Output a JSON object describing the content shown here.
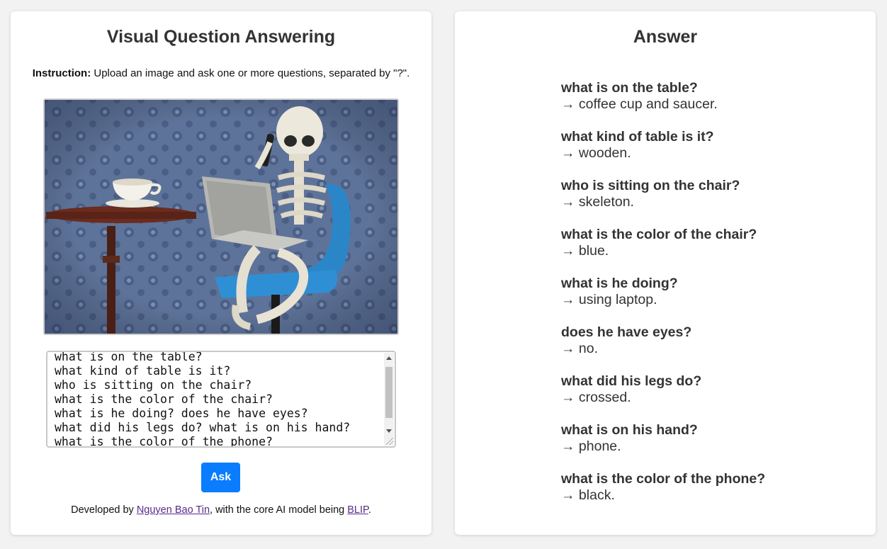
{
  "left": {
    "title": "Visual Question Answering",
    "instruction_label": "Instruction:",
    "instruction_text": " Upload an image and ask one or more questions, separated by \"?\".",
    "questions_text": "what is on the table?\nwhat kind of table is it?\nwho is sitting on the chair?\nwhat is the color of the chair?\nwhat is he doing? does he have eyes?\nwhat did his legs do? what is on his hand?\nwhat is the color of the phone?",
    "ask_label": "Ask",
    "footer": {
      "prefix": "Developed by ",
      "author": "Nguyen Bao Tin",
      "middle": ", with the core AI model being ",
      "model": "BLIP",
      "suffix": "."
    }
  },
  "right": {
    "title": "Answer",
    "answers": [
      {
        "q": "what is on the table?",
        "a": "→ coffee cup and saucer."
      },
      {
        "q": "what kind of table is it?",
        "a": "→ wooden."
      },
      {
        "q": "who is sitting on the chair?",
        "a": "→ skeleton."
      },
      {
        "q": "what is the color of the chair?",
        "a": "→ blue."
      },
      {
        "q": "what is he doing?",
        "a": "→ using laptop."
      },
      {
        "q": "does he have eyes?",
        "a": "→ no."
      },
      {
        "q": "what did his legs do?",
        "a": "→ crossed."
      },
      {
        "q": "what is on his hand?",
        "a": "→ phone."
      },
      {
        "q": "what is the color of the phone?",
        "a": "→ black."
      }
    ]
  },
  "colors": {
    "button": "#0a7cff",
    "link": "#5a2a8a",
    "background": "#f2f2f2"
  }
}
